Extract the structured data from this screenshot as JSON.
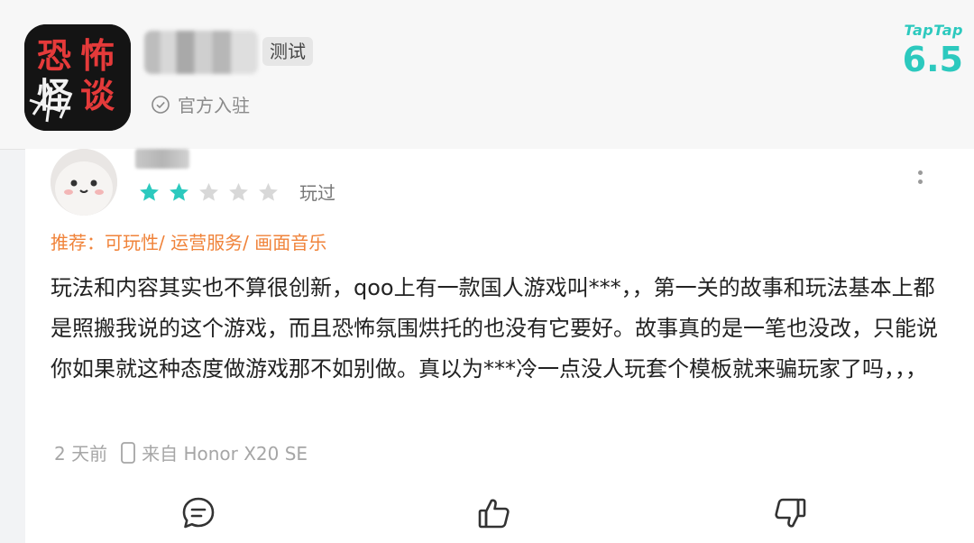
{
  "header": {
    "app_name": "恐怖怪谈",
    "test_badge": "测试",
    "official_label": "官方入驻",
    "brand": "TapTap",
    "score": "6.5"
  },
  "review": {
    "rating": 2,
    "max_rating": 5,
    "status": "玩过",
    "tags": "推荐：可玩性/ 运营服务/ 画面音乐",
    "content": "玩法和内容其实也不算很创新，qoo上有一款国人游戏叫***，，第一关的故事和玩法基本上都是照搬我说的这个游戏，而且恐怖氛围烘托的也没有它要好。故事真的是一笔也没改，只能说你如果就这种态度做游戏那不如别做。真以为***冷一点没人玩套个模板就来骗玩家了吗，，，",
    "time": "2 天前",
    "device": "来自 Honor X20 SE"
  },
  "colors": {
    "accent": "#2cc9be",
    "tag": "#f0833a",
    "star_empty": "#d8d8d8"
  },
  "icons": [
    "check-circle-icon",
    "more-icon",
    "phone-icon",
    "comment-icon",
    "thumbs-up-icon",
    "thumbs-down-icon"
  ]
}
